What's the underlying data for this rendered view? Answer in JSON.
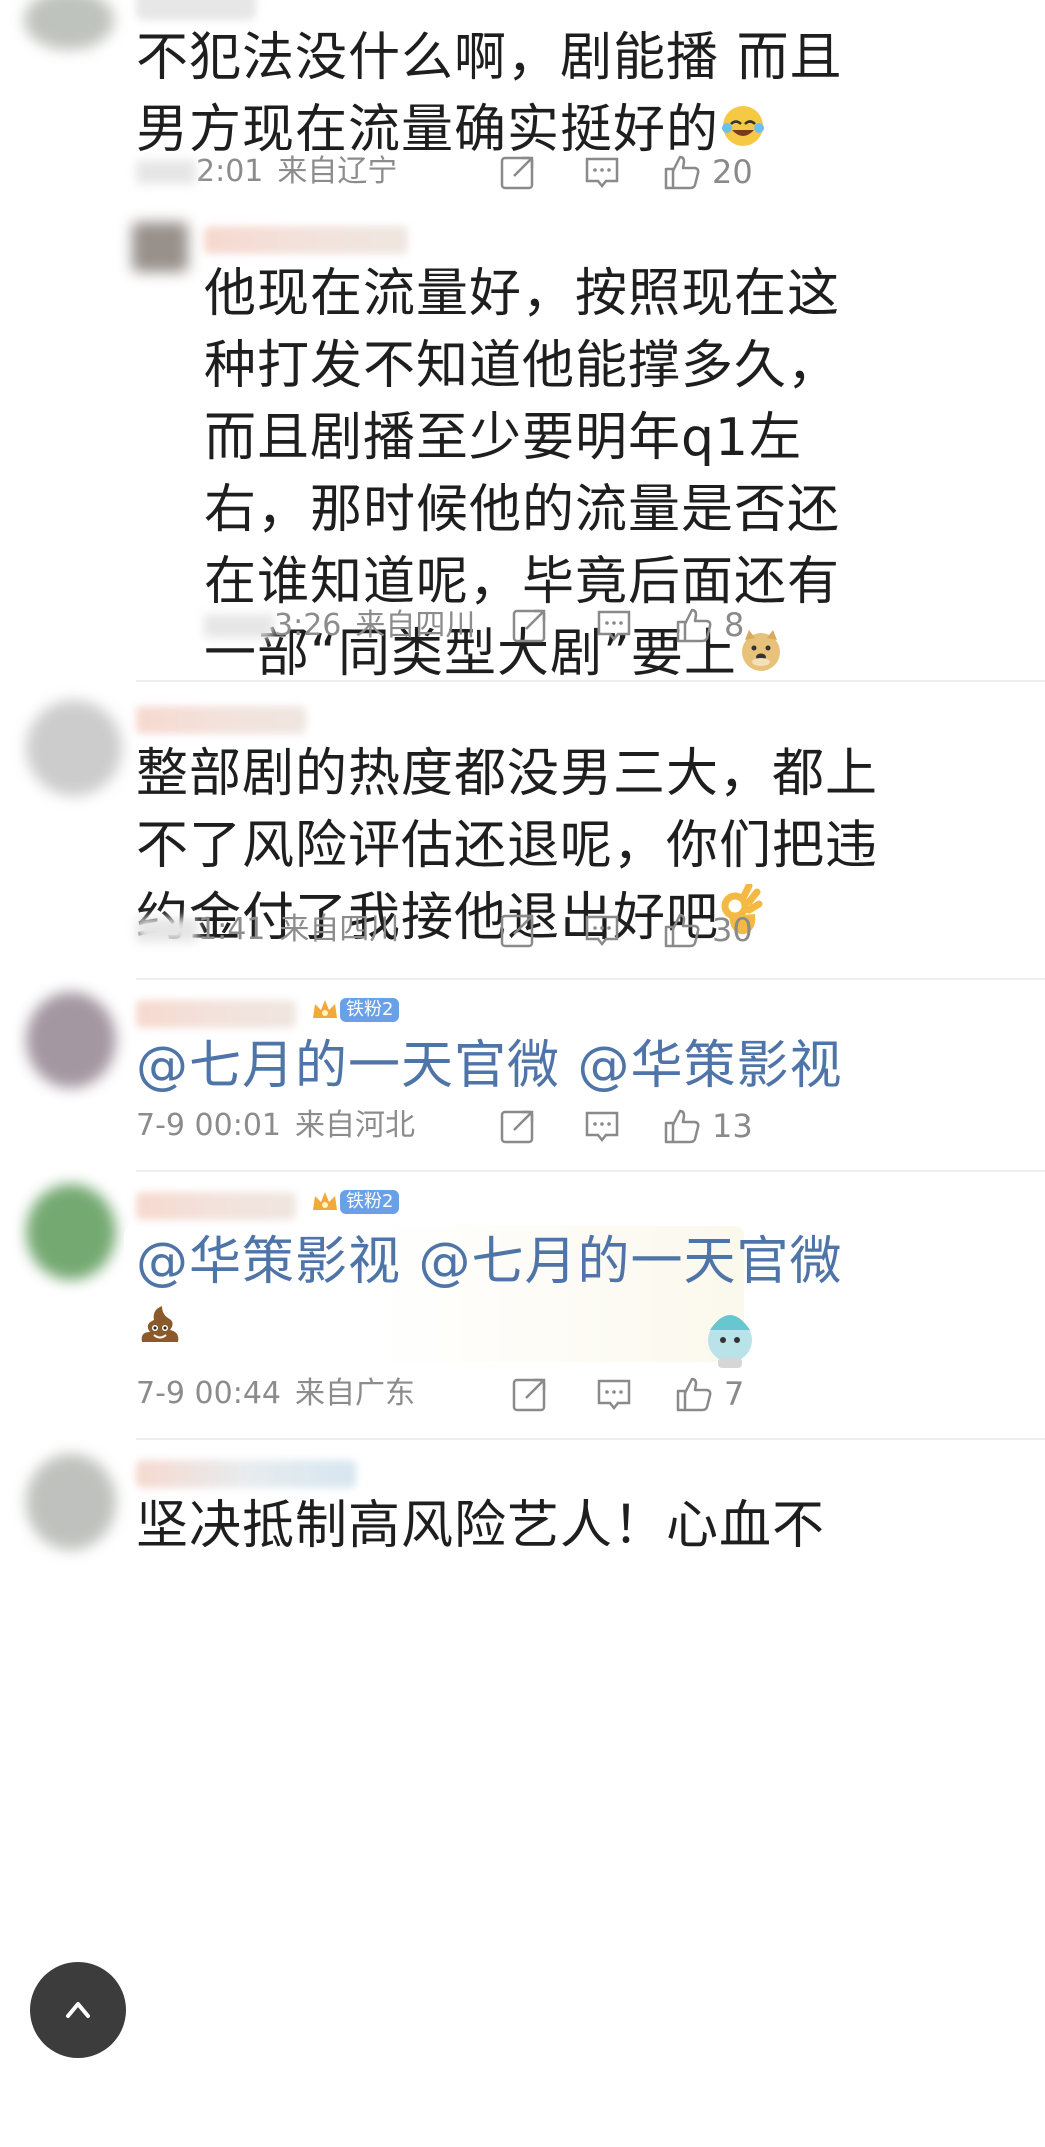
{
  "comments": [
    {
      "lines": [
        "不犯法没什么啊，剧能播 而且",
        "男方现在流量确实挺好的"
      ],
      "time": "2:01",
      "location": "来自辽宁",
      "likes": "20",
      "emoji": "laughing-tears"
    },
    {
      "lines": [
        "他现在流量好，按照现在这",
        "种打发不知道他能撑多久，",
        "而且剧播至少要明年q1左",
        "右，那时候他的流量是否还",
        "在谁知道呢，毕竟后面还有",
        "一部“同类型大剧”要上"
      ],
      "time": "3:26",
      "location": "来自四川",
      "likes": "8",
      "emoji": "doge"
    },
    {
      "lines": [
        "整部剧的热度都没男三大，都上",
        "不了风险评估还退呢，你们把违",
        "约金付了我接他退出好吧"
      ],
      "time": "1:41",
      "location": "来自四川",
      "likes": "30",
      "emoji": "ok-hand"
    },
    {
      "lines": [
        "@七月的一天官微 @华策影视"
      ],
      "badge": "铁粉2",
      "time": "7-9 00:01",
      "location": "来自河北",
      "likes": "13"
    },
    {
      "lines": [
        "@华策影视 @七月的一天官微"
      ],
      "badge": "铁粉2",
      "time": "7-9 00:44",
      "location": "来自广东",
      "likes": "7",
      "emoji": "poop"
    },
    {
      "lines": [
        "坚决抵制高风险艺人！心血不"
      ]
    }
  ],
  "colors": {
    "mention": "#4f74a8",
    "meta": "#8c8c8c",
    "badge": "#6aa0e8"
  },
  "icons": [
    "repost-icon",
    "comment-icon",
    "like-icon",
    "back-to-top-icon"
  ]
}
